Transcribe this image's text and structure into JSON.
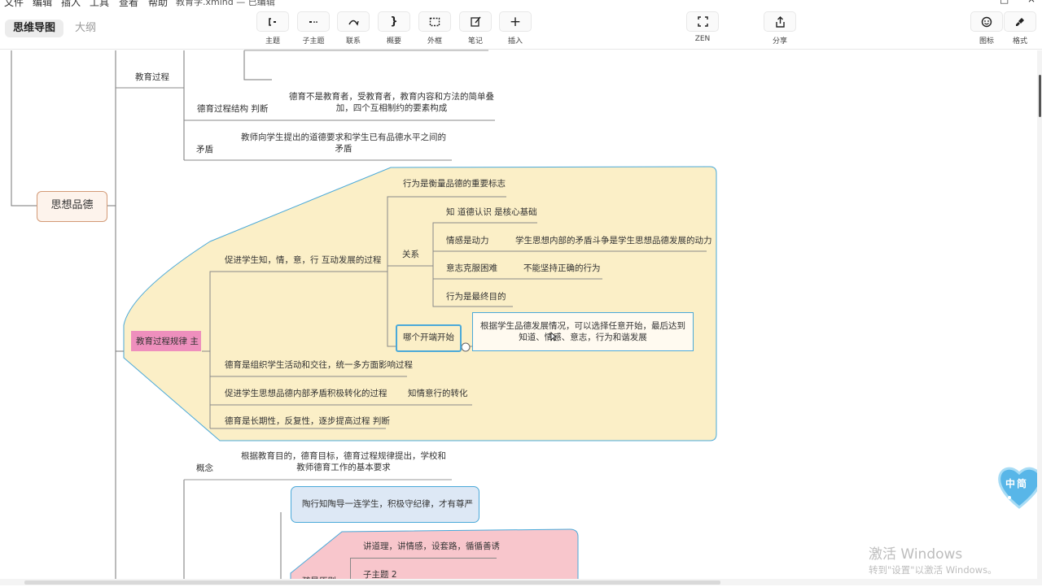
{
  "menu": [
    "文件",
    "编辑",
    "插入",
    "工具",
    "查看",
    "帮助"
  ],
  "window_title": "教育学.xmind — 已编辑",
  "view_tabs": {
    "mindmap": "思维导图",
    "outline": "大纲"
  },
  "toolbar": {
    "topic": "主题",
    "subtopic": "子主题",
    "relation": "联系",
    "summary": "概要",
    "boundary": "外框",
    "note": "笔记",
    "insert": "插入",
    "zen": "ZEN",
    "share": "分享",
    "icon": "图标",
    "format": "格式"
  },
  "map": {
    "root": "思想品德",
    "process": "教育过程",
    "structure": "德育过程结构 判断",
    "structure_desc": "德育不是教育者，受教育者，教育内容和方法的简单叠加，四个互相制约的要素构成",
    "contradiction": "矛盾",
    "contradiction_desc": "教师向学生提出的道德要求和学生已有品德水平之间的矛盾",
    "law": "教育过程规律 主",
    "promote": "促进学生知，情，意，行 互动发展的过程",
    "behavior_mark": "行为是衡量品德的重要标志",
    "relation": "关系",
    "know": "知  道德认识 是核心基础",
    "emotion": "情感是动力",
    "emotion_desc": "学生思想内部的矛盾斗争是学生思想品德发展的动力",
    "will": "意志克服困难",
    "will_desc": "不能坚持正确的行为",
    "behavior_goal": "行为是最终目的",
    "start": "哪个开端开始",
    "start_desc": "根据学生品德发展情况，可以选择任意开始，最后达到知道、情感、意志，行为和谐发展",
    "org": "德育是组织学生活动和交往，统一多方面影响过程",
    "transform": "促进学生思想品德内部矛盾积极转化的过程",
    "transform_desc": "知情意行的转化",
    "long": "德育是长期性，反复性，逐步提高过程 判断",
    "concept": "概念",
    "concept_desc": "根据教育目的，德育目标，德育过程规律提出，学校和教师德育工作的基本要求",
    "tao": "陶行知陶导一连学生，积极守纪律，才有尊严",
    "guide": "讲道理，讲情感，设套路，循循善诱",
    "sub2": "子主题 2",
    "principle": "疏导原则"
  },
  "badge": "中简",
  "watermark": {
    "line1": "激活 Windows",
    "line2": "转到\"设置\"以激活 Windows。"
  },
  "colors": {
    "law_fill": "#fbefc7",
    "law_node": "#ee8fbd",
    "blue": "#4aa9d9",
    "pink_area": "#f8c6cc"
  }
}
